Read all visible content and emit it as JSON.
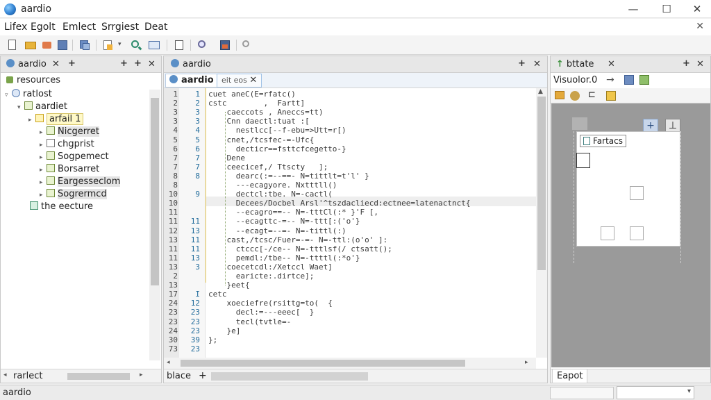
{
  "window": {
    "title": "aardio",
    "minimize": "—",
    "maximize": "☐",
    "close": "✕"
  },
  "menu": {
    "items": [
      "Lifex",
      "Egolt",
      "Emlect",
      "Srrgiest",
      "Deat"
    ],
    "close": "✕"
  },
  "left_panel": {
    "tab_label": "aardio",
    "tab_close": "✕",
    "tab_add": "+",
    "header": "resources",
    "tree": [
      {
        "label": "ratlost",
        "level": 0
      },
      {
        "label": "aardiet",
        "level": 1
      },
      {
        "label": "arfail 1",
        "level": 2
      },
      {
        "label": "Nicgerret",
        "level": 3
      },
      {
        "label": "chgprist",
        "level": 3
      },
      {
        "label": "Sogpemect",
        "level": 3
      },
      {
        "label": "Borsarret",
        "level": 3
      },
      {
        "label": "Eargesseclom",
        "level": 3
      },
      {
        "label": "Sogrermcd",
        "level": 3
      },
      {
        "label": "the eecture",
        "level": 1
      }
    ],
    "footer": "rarlect"
  },
  "editor": {
    "tab_label": "aardio",
    "tab2_label": "eit eos",
    "tab_close": "✕",
    "bottom_label": "blace",
    "bottom_add": "+",
    "line_numbers": [
      "1",
      "2",
      "3",
      "3",
      "4",
      "5",
      "6",
      "7",
      "7",
      "8",
      "8",
      "10",
      "10",
      "11",
      "11",
      "12",
      "13",
      "11",
      "11",
      "13",
      "2",
      "13",
      "17",
      "24",
      "23",
      "23",
      "24",
      "30",
      "73"
    ],
    "line_numbers2": [
      "1",
      "2",
      "3",
      "3",
      "4",
      "5",
      "6",
      "7",
      "7",
      "8",
      "",
      "9",
      "",
      "",
      "11",
      "13",
      "11",
      "11",
      "13",
      "3",
      "",
      "",
      "I",
      "12",
      "23",
      "23",
      "23",
      "39",
      "23"
    ],
    "lines": [
      "cuet aneC(E=rfatc()",
      "cstc        ,  Fartt]",
      "    caeccots , Aneccs=tt)",
      "    Cnn daectl:tuat :[",
      "      nestlcc[--f-ebu=>Utt=r[)",
      "    cnet,/tcsfec-=-Ufc{",
      "      decticr==fsttcfcegetto-}",
      "    Dene",
      "    ceecicef,/ Ttscty   ];",
      "      dearc(:=--==- N=tittlt=t'l' }",
      "      ---ecagyore. Nxtttll()",
      "      dectcl:tbe. N=-cactl(",
      "      Decees/Docbel Arsl'^tszdacliecd:ectnee=latenactnct{",
      "      --ecagro==-- N=-tttCl(:* }'F [,",
      "      --ecagttc-=-- N=-ttt[:('o'}",
      "      --ecagt=--=- N=-tittl(:)",
      "    cast,/tcsc/Fuer=-=- N=-ttl:(o'o' ]:",
      "      ctccc[-/ce-- N=-tttlsf(/ ctsatt();",
      "      pemdl:/tbe-- N=-ttttl(:*o'}",
      "    coecetcdl:/Xetccl Waet]",
      "      earicte:.dirtce];",
      "    }eet{",
      "cetc",
      "    xoeciefre(rsittg=to(  {",
      "      decl:=---eeec[  }",
      "      tecl(tvtle=-",
      "    }e]",
      "};",
      ""
    ]
  },
  "right_panel": {
    "tab_label": "bttate",
    "tab_close": "✕",
    "tab_add": "+",
    "toolbar_label": "Visuolor.0",
    "form_label": "Fartacs",
    "footer": "Eapot"
  },
  "status": {
    "text": "aardio"
  },
  "icons": {
    "logo": "aardio-logo-icon",
    "new": "new-file-icon",
    "open": "open-folder-icon",
    "save": "save-icon",
    "search": "search-icon",
    "zoom": "zoom-icon"
  }
}
